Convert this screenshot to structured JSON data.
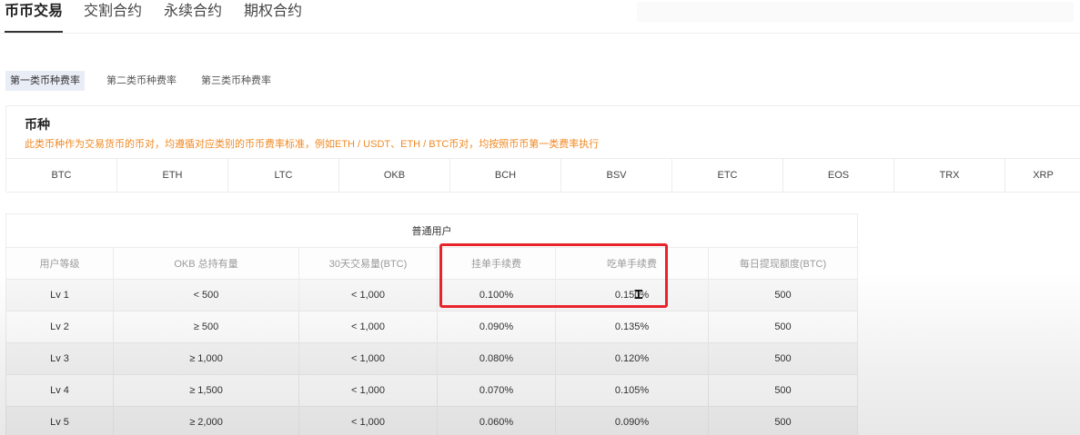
{
  "top_tabs": [
    {
      "label": "币币交易",
      "active": true
    },
    {
      "label": "交割合约",
      "active": false
    },
    {
      "label": "永续合约",
      "active": false
    },
    {
      "label": "期权合约",
      "active": false
    }
  ],
  "sub_tabs": [
    {
      "label": "第一类币种费率",
      "active": true
    },
    {
      "label": "第二类币种费率",
      "active": false
    },
    {
      "label": "第三类币种费率",
      "active": false
    }
  ],
  "coin_section": {
    "title": "币种",
    "note": "此类币种作为交易货币的币对，均遵循对应类别的币币费率标准，例如ETH / USDT、ETH / BTC币对，均按照币币第一类费率执行",
    "note_color": "#f08a24",
    "coins": [
      "BTC",
      "ETH",
      "LTC",
      "OKB",
      "BCH",
      "BSV",
      "ETC",
      "EOS",
      "TRX",
      "XRP"
    ]
  },
  "fee_table": {
    "group_header": "普通用户",
    "columns": [
      "用户等级",
      "OKB 总持有量",
      "30天交易量(BTC)",
      "挂单手续费",
      "吃单手续费",
      "每日提现额度(BTC)"
    ],
    "rows": [
      [
        "Lv 1",
        "< 500",
        "< 1,000",
        "0.100%",
        "0.150%",
        "500"
      ],
      [
        "Lv 2",
        "≥ 500",
        "< 1,000",
        "0.090%",
        "0.135%",
        "500"
      ],
      [
        "Lv 3",
        "≥ 1,000",
        "< 1,000",
        "0.080%",
        "0.120%",
        "500"
      ],
      [
        "Lv 4",
        "≥ 1,500",
        "< 1,000",
        "0.070%",
        "0.105%",
        "500"
      ],
      [
        "Lv 5",
        "≥ 2,000",
        "< 1,000",
        "0.060%",
        "0.090%",
        "500"
      ]
    ]
  },
  "highlight_color": "#e8242a"
}
